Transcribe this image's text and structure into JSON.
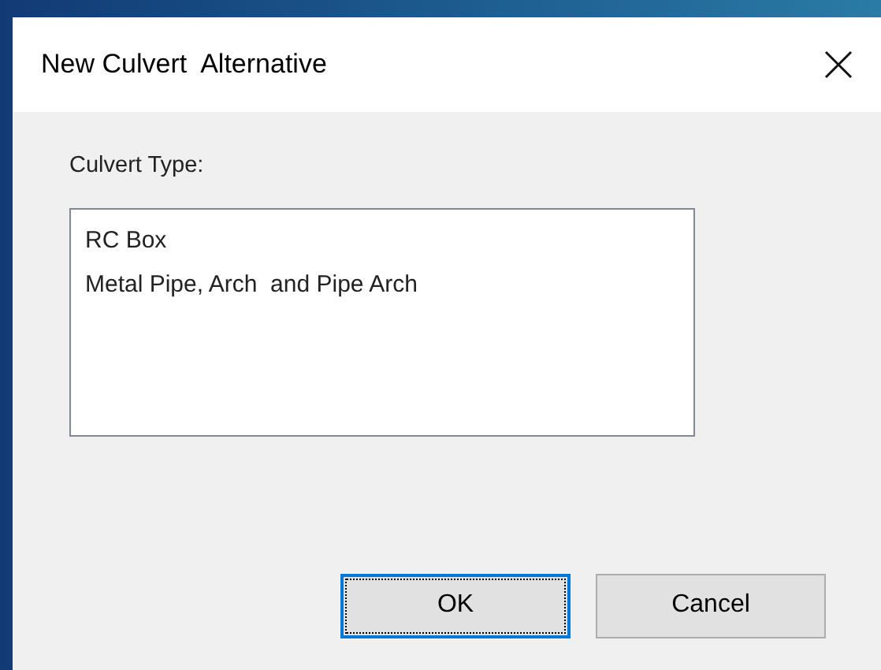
{
  "window": {
    "title": "New Culvert  Alternative"
  },
  "culvert_type": {
    "label": "Culvert Type:",
    "items": [
      {
        "label": "RC Box"
      },
      {
        "label": "Metal Pipe, Arch  and Pipe Arch"
      }
    ]
  },
  "buttons": [
    {
      "label": "OK",
      "default": true
    },
    {
      "label": "Cancel",
      "default": false
    }
  ]
}
